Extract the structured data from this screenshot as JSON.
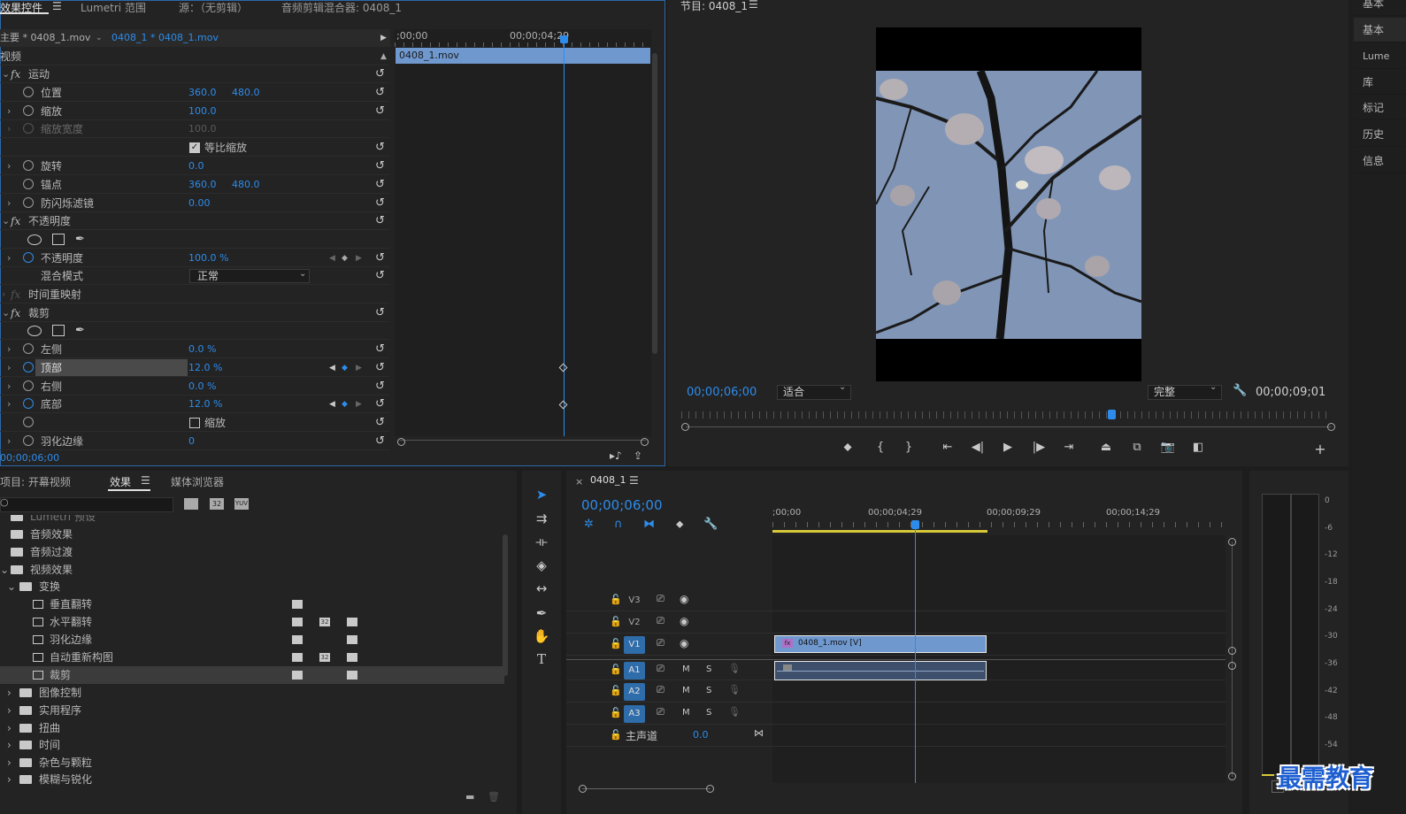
{
  "effect_controls": {
    "tabs": [
      "效果控件",
      "Lumetri 范围",
      "源：（无剪辑）",
      "音频剪辑混合器: 0408_1"
    ],
    "master_clip": "主要 * 0408_1.mov",
    "sequence_clip": "0408_1 * 0408_1.mov",
    "section_video": "视频",
    "timeline_start": ";00;00",
    "timeline_mid": "00;00;04;29",
    "clip_name": "0408_1.mov",
    "rows": {
      "motion": "运动",
      "position": "位置",
      "position_x": "360.0",
      "position_y": "480.0",
      "scale": "缩放",
      "scale_val": "100.0",
      "scale_width": "缩放宽度",
      "scale_width_val": "100.0",
      "uniform_scale": "等比缩放",
      "rotation": "旋转",
      "rotation_val": "0.0",
      "anchor": "锚点",
      "anchor_x": "360.0",
      "anchor_y": "480.0",
      "anti_flicker": "防闪烁滤镜",
      "anti_flicker_val": "0.00",
      "opacity_group": "不透明度",
      "opacity": "不透明度",
      "opacity_val": "100.0 %",
      "blend_mode": "混合模式",
      "blend_mode_val": "正常",
      "time_remap": "时间重映射",
      "crop": "裁剪",
      "left": "左侧",
      "left_val": "0.0 %",
      "top": "顶部",
      "top_val": "12.0 %",
      "right": "右侧",
      "right_val": "0.0 %",
      "bottom": "底部",
      "bottom_val": "12.0 %",
      "zoom": "缩放",
      "feather": "羽化边缘",
      "feather_val": "0"
    },
    "timecode": "00;00;06;00"
  },
  "program_monitor": {
    "title": "节目: 0408_1",
    "current_time": "00;00;06;00",
    "fit": "适合",
    "quality": "完整",
    "duration": "00;00;09;01"
  },
  "right_panel": {
    "tabs": [
      "基本",
      "基本",
      "Lume",
      "库",
      "标记",
      "历史",
      "信息"
    ]
  },
  "project_panel": {
    "tabs": [
      "项目: 开幕视频",
      "效果",
      "媒体浏览器"
    ],
    "search_placeholder": "",
    "items": {
      "lumetri": "Lumetri 预设",
      "audio_effects": "音频效果",
      "audio_transitions": "音频过渡",
      "video_effects": "视频效果",
      "transform": "变换",
      "vflip": "垂直翻转",
      "hflip": "水平翻转",
      "feather_edges": "羽化边缘",
      "auto_reframe": "自动重新构图",
      "crop": "裁剪",
      "image_control": "图像控制",
      "utility": "实用程序",
      "distort": "扭曲",
      "time": "时间",
      "noise_grain": "杂色与颗粒",
      "blur_sharpen": "模糊与锐化"
    }
  },
  "timeline": {
    "tab": "0408_1",
    "timecode": "00;00;06;00",
    "ruler": [
      ";00;00",
      "00;00;04;29",
      "00;00;09;29",
      "00;00;14;29"
    ],
    "tracks": [
      "V3",
      "V2",
      "V1",
      "A1",
      "A2",
      "A3"
    ],
    "mute": "M",
    "solo": "S",
    "master": "主声道",
    "master_val": "0.0",
    "video_clip": "0408_1.mov [V]"
  },
  "meter": {
    "ticks": [
      "0",
      "-6",
      "-12",
      "-18",
      "-24",
      "-30",
      "-36",
      "-42",
      "-48",
      "-54"
    ],
    "solo_label": "S"
  },
  "watermark": "最需教育"
}
